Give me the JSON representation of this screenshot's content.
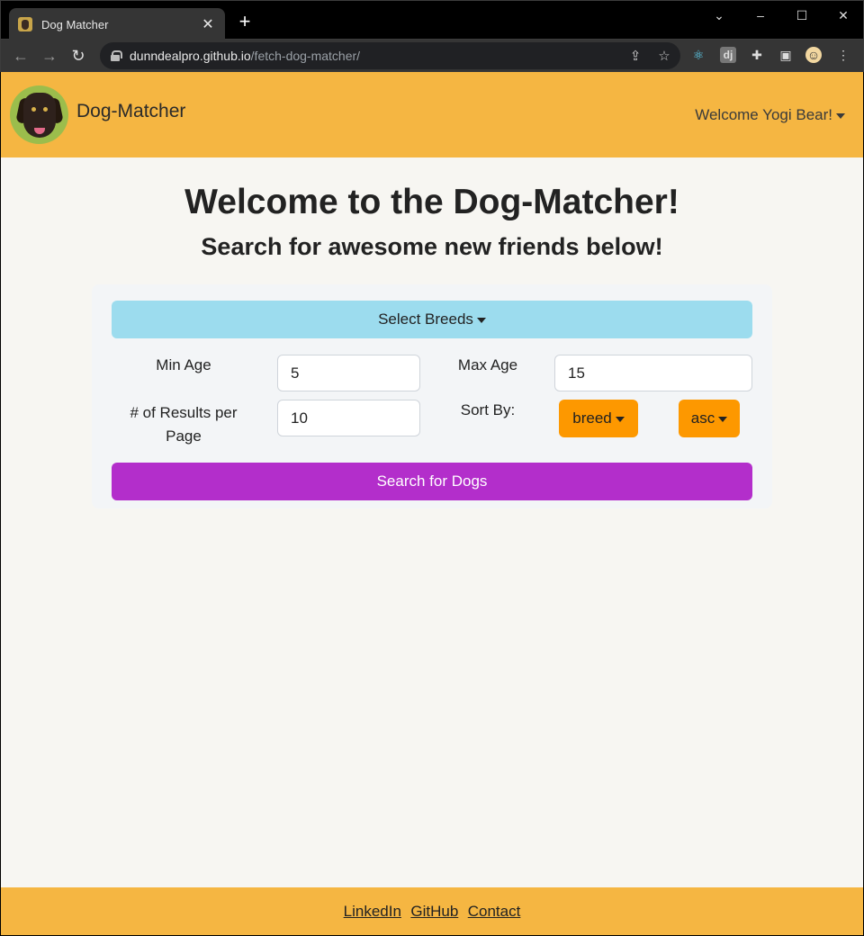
{
  "browser": {
    "tab_title": "Dog Matcher",
    "tab_close": "✕",
    "new_tab": "+",
    "url_host": "dunndealpro.github.io",
    "url_path": "/fetch-dog-matcher/"
  },
  "header": {
    "brand": "Dog-Matcher",
    "user_menu": "Welcome Yogi Bear!"
  },
  "main": {
    "title": "Welcome to the Dog-Matcher!",
    "subtitle": "Search for awesome new friends below!"
  },
  "search_form": {
    "breeds_button": "Select Breeds",
    "min_age_label": "Min Age",
    "min_age_value": "5",
    "max_age_label": "Max Age",
    "max_age_value": "15",
    "results_label": "# of Results per Page",
    "results_value": "10",
    "sort_label": "Sort By:",
    "sort_field": "breed",
    "sort_order": "asc",
    "search_button": "Search for Dogs"
  },
  "footer": {
    "links": [
      "LinkedIn",
      "GitHub",
      "Contact"
    ]
  },
  "colors": {
    "navbar": "#f5b642",
    "breeds_button": "#9cdcee",
    "sort_buttons": "#fd9800",
    "search_button": "#b32ecb"
  }
}
